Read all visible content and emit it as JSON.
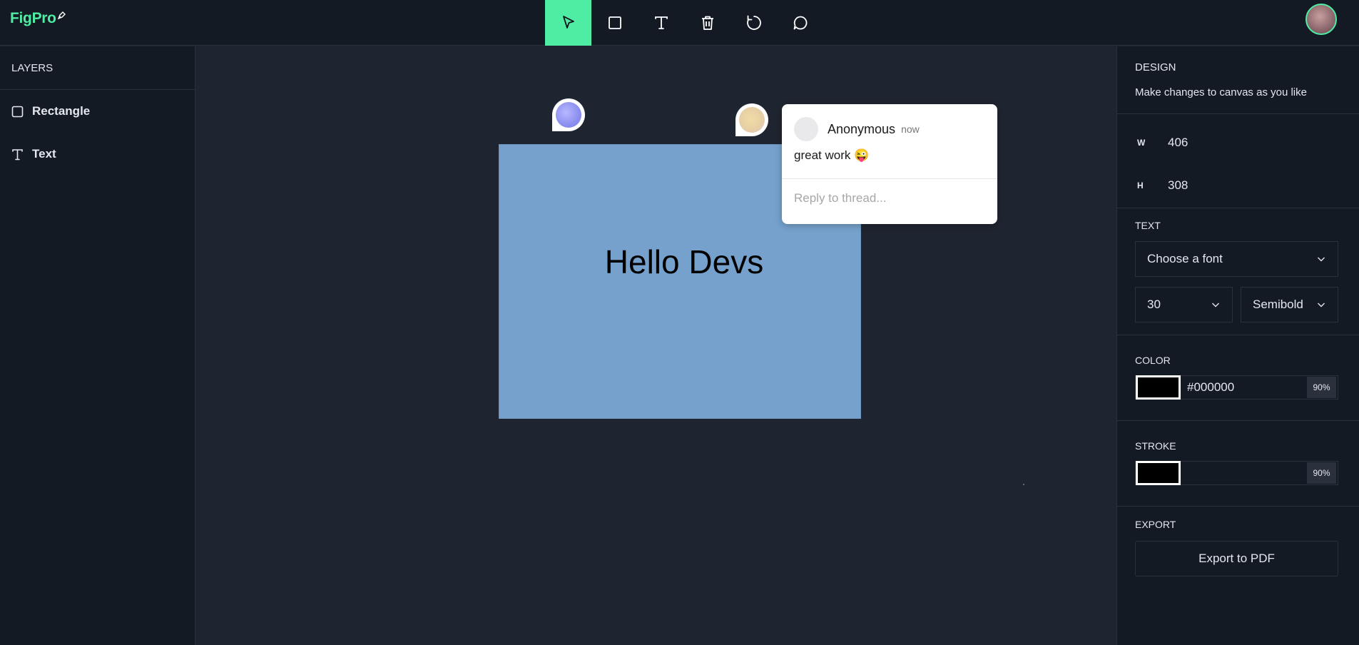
{
  "app": {
    "logo": "FigPro"
  },
  "toolbar": {
    "tools": [
      {
        "name": "select",
        "icon": "cursor-icon",
        "active": true
      },
      {
        "name": "rectangle",
        "icon": "square-icon",
        "active": false
      },
      {
        "name": "text",
        "icon": "text-icon",
        "active": false
      },
      {
        "name": "delete",
        "icon": "trash-icon",
        "active": false
      },
      {
        "name": "reset",
        "icon": "refresh-icon",
        "active": false
      },
      {
        "name": "comments",
        "icon": "comment-icon",
        "active": false
      }
    ],
    "active_color": "#4eeda3"
  },
  "layers": {
    "title": "LAYERS",
    "items": [
      {
        "label": "Rectangle",
        "icon": "square-icon"
      },
      {
        "label": "Text",
        "icon": "text-icon"
      }
    ]
  },
  "canvas": {
    "rectangle_fill": "#75a1cc",
    "text": "Hello Devs",
    "thread": {
      "author": "Anonymous",
      "time": "now",
      "message": "great work",
      "emoji": "😜",
      "reply_placeholder": "Reply to thread..."
    }
  },
  "design": {
    "title": "DESIGN",
    "subtitle": "Make changes to canvas as you like",
    "width_label": "W",
    "width_value": "406",
    "height_label": "H",
    "height_value": "308",
    "text_title": "TEXT",
    "font_placeholder": "Choose a font",
    "font_size": "30",
    "font_weight": "Semibold",
    "color_title": "COLOR",
    "color_hex": "#000000",
    "color_opacity": "90%",
    "stroke_title": "STROKE",
    "stroke_opacity": "90%",
    "export_title": "EXPORT",
    "export_button": "Export to PDF"
  }
}
